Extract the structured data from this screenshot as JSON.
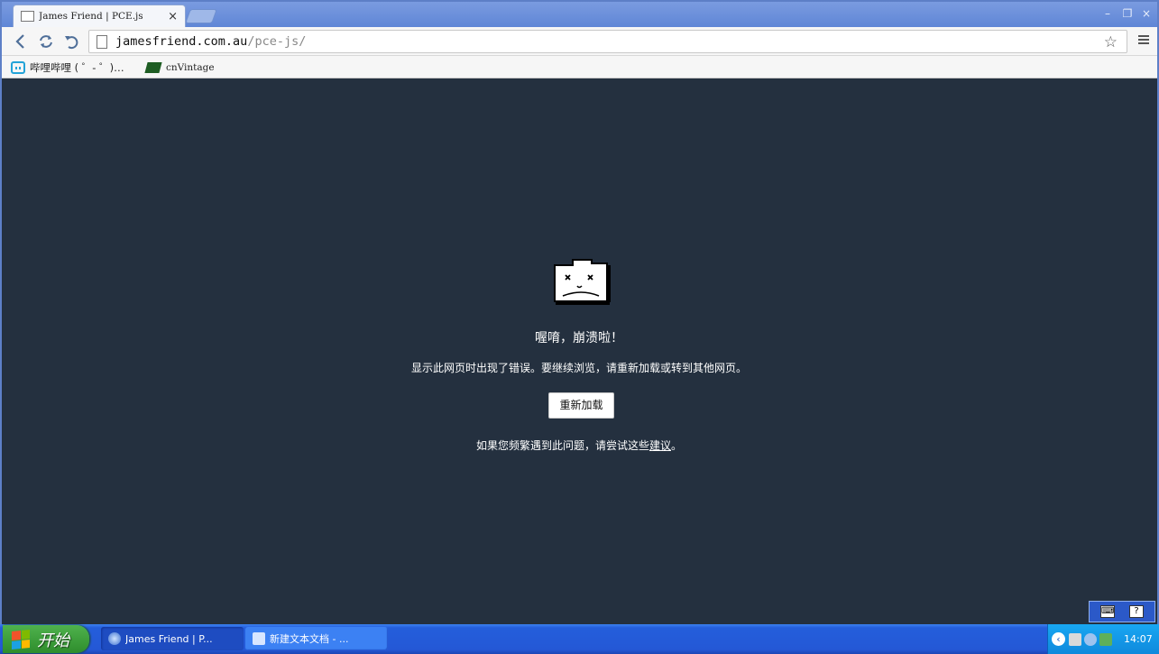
{
  "browser": {
    "tab_title": "James Friend | PCE.js",
    "tab_close": "×",
    "url_host": "jamesfriend.com.au",
    "url_path": "/pce-js/",
    "star_icon": "☆",
    "window_controls": {
      "minimize": "–",
      "restore": "❐",
      "close": "×"
    },
    "bookmarks": [
      {
        "label": "哔哩哔哩 ( ゜- ゜)…",
        "icon": "bilibili-icon"
      },
      {
        "label": "cnVintage",
        "icon": "cnvintage-icon"
      }
    ]
  },
  "error_page": {
    "title": "喔唷，崩溃啦！",
    "description": "显示此网页时出现了错误。要继续浏览，请重新加载或转到其他网页。",
    "reload_label": "重新加载",
    "hint_prefix": "如果您频繁遇到此问题，请尝试这些",
    "hint_link": "建议",
    "hint_suffix": "。"
  },
  "ime": {
    "keyboard": "⌨",
    "help": "?"
  },
  "taskbar": {
    "start_label": "开始",
    "tasks": [
      {
        "label": "James Friend | P...",
        "active": true
      },
      {
        "label": "新建文本文档 - ...",
        "active": false
      }
    ],
    "tray_arrow": "‹",
    "clock": "14:07"
  },
  "colors": {
    "page_background": "#24303f",
    "title_bar": "#6a8fda",
    "taskbar": "#245edb",
    "start_button": "#3a9d38"
  }
}
